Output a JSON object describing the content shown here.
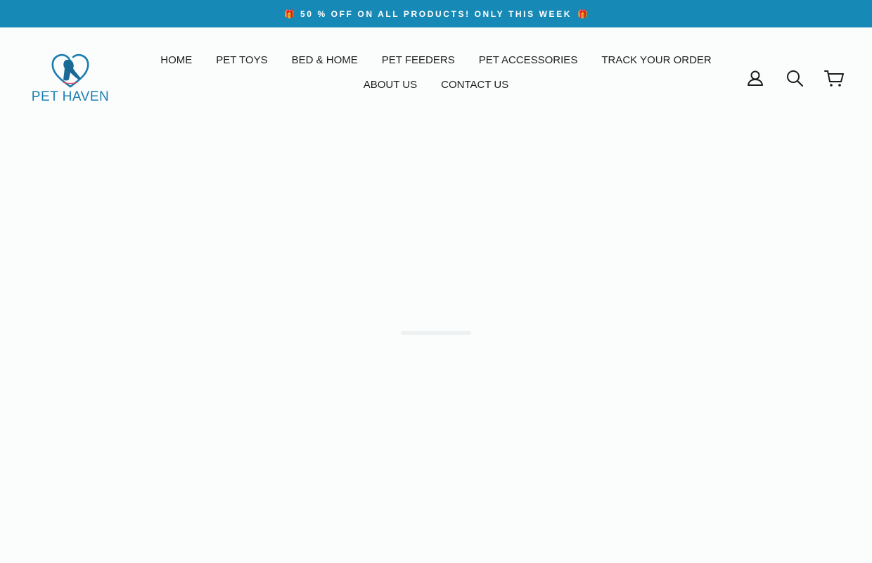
{
  "announcement": {
    "text": "50 % OFF ON ALL PRODUCTS! ONLY THIS WEEK",
    "icon": "gift-icon",
    "background": "#1789b7"
  },
  "logo": {
    "text": "PET HAVEN",
    "color": "#1a7db0"
  },
  "nav": {
    "items": [
      "HOME",
      "PET TOYS",
      "BED & HOME",
      "PET FEEDERS",
      "PET ACCESSORIES",
      "TRACK YOUR ORDER",
      "ABOUT US",
      "CONTACT US"
    ]
  },
  "header_icons": {
    "login": {
      "label": "Log in",
      "icon": "user-icon"
    },
    "search": {
      "label": "Search",
      "icon": "search-icon"
    },
    "cart": {
      "label": "Cart",
      "icon": "cart-icon"
    }
  }
}
